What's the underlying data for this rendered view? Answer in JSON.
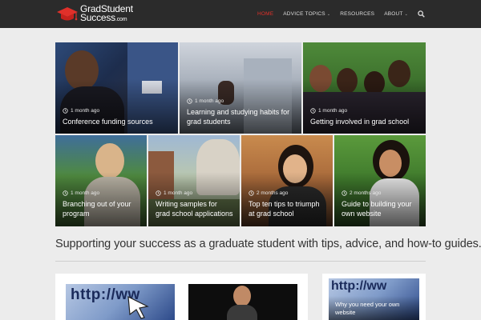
{
  "site": {
    "logo_line1": "GradStudent",
    "logo_line2": "Success",
    "logo_suffix": ".com"
  },
  "nav": {
    "items": [
      {
        "label": "HOME",
        "active": true,
        "has_dropdown": false
      },
      {
        "label": "ADVICE TOPICS",
        "active": false,
        "has_dropdown": true
      },
      {
        "label": "RESOURCES",
        "active": false,
        "has_dropdown": false
      },
      {
        "label": "ABOUT",
        "active": false,
        "has_dropdown": true
      }
    ],
    "search_icon": "search-icon"
  },
  "featured": [
    {
      "time": "1 month ago",
      "title": "Conference funding sources"
    },
    {
      "time": "1 month ago",
      "title": "Learning and studying habits for grad students"
    },
    {
      "time": "1 month ago",
      "title": "Getting involved in grad school"
    },
    {
      "time": "1 month ago",
      "title": "Branching out of your program"
    },
    {
      "time": "1 month ago",
      "title": "Writing samples for grad school applications"
    },
    {
      "time": "2 months ago",
      "title": "Top ten tips to triumph at grad school"
    },
    {
      "time": "2 months ago",
      "title": "Guide to building your own website"
    }
  ],
  "tagline": "Supporting your success as a graduate student with tips, advice, and how-to guides.",
  "cards": {
    "sidebar_title": "Why you need your own website",
    "thumb_text": "http://ww"
  },
  "colors": {
    "header_bg": "#2b2b2b",
    "accent": "#e0302a",
    "page_bg": "#ececec"
  }
}
